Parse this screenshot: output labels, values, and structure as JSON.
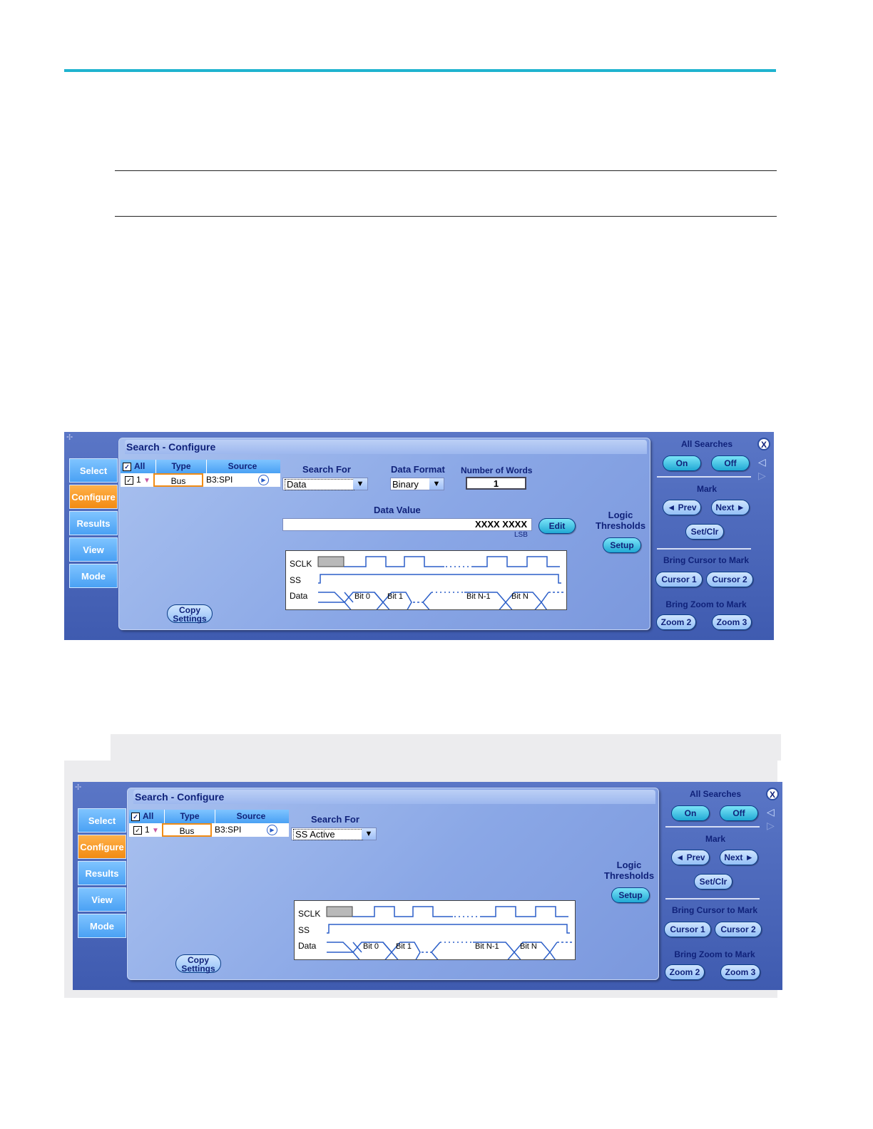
{
  "screens": [
    {
      "title": "Search - Configure",
      "tabs": [
        "Select",
        "Configure",
        "Results",
        "View",
        "Mode"
      ],
      "grid": {
        "col_all": "All",
        "col_type": "Type",
        "col_source": "Source",
        "row_num": "1",
        "row_type": "Bus",
        "row_source": "B3:SPI"
      },
      "search_for_label": "Search For",
      "search_for_value": "Data",
      "data_format_label": "Data Format",
      "data_format_value": "Binary",
      "words_label": "Number of Words",
      "words_value": "1",
      "data_value_label": "Data Value",
      "data_value": "XXXX XXXX",
      "lsb": "LSB",
      "edit": "Edit",
      "logic_thresholds": "Logic Thresholds",
      "setup": "Setup",
      "copy_settings": "Copy Settings",
      "diagram": {
        "sclk": "SCLK",
        "ss": "SS",
        "data": "Data",
        "bits": [
          "Bit 0",
          "Bit 1",
          "Bit N-1",
          "Bit N"
        ]
      },
      "right": {
        "all_searches": "All Searches",
        "on": "On",
        "off": "Off",
        "mark": "Mark",
        "prev": "◄ Prev",
        "next": "Next ►",
        "setclr": "Set/Clr",
        "bring_cursor": "Bring Cursor to Mark",
        "cursor1": "Cursor 1",
        "cursor2": "Cursor 2",
        "bring_zoom": "Bring Zoom to Mark",
        "zoom2": "Zoom 2",
        "zoom3": "Zoom 3",
        "close": "X"
      }
    },
    {
      "title": "Search - Configure",
      "tabs": [
        "Select",
        "Configure",
        "Results",
        "View",
        "Mode"
      ],
      "grid": {
        "col_all": "All",
        "col_type": "Type",
        "col_source": "Source",
        "row_num": "1",
        "row_type": "Bus",
        "row_source": "B3:SPI"
      },
      "search_for_label": "Search For",
      "search_for_value": "SS Active",
      "logic_thresholds": "Logic Thresholds",
      "setup": "Setup",
      "copy_settings": "Copy Settings",
      "diagram": {
        "sclk": "SCLK",
        "ss": "SS",
        "data": "Data",
        "bits": [
          "Bit 0",
          "Bit 1",
          "Bit N-1",
          "Bit N"
        ]
      },
      "right": {
        "all_searches": "All Searches",
        "on": "On",
        "off": "Off",
        "mark": "Mark",
        "prev": "◄ Prev",
        "next": "Next ►",
        "setclr": "Set/Clr",
        "bring_cursor": "Bring Cursor to Mark",
        "cursor1": "Cursor 1",
        "cursor2": "Cursor 2",
        "bring_zoom": "Bring Zoom to Mark",
        "zoom2": "Zoom 2",
        "zoom3": "Zoom 3",
        "close": "X"
      }
    }
  ]
}
